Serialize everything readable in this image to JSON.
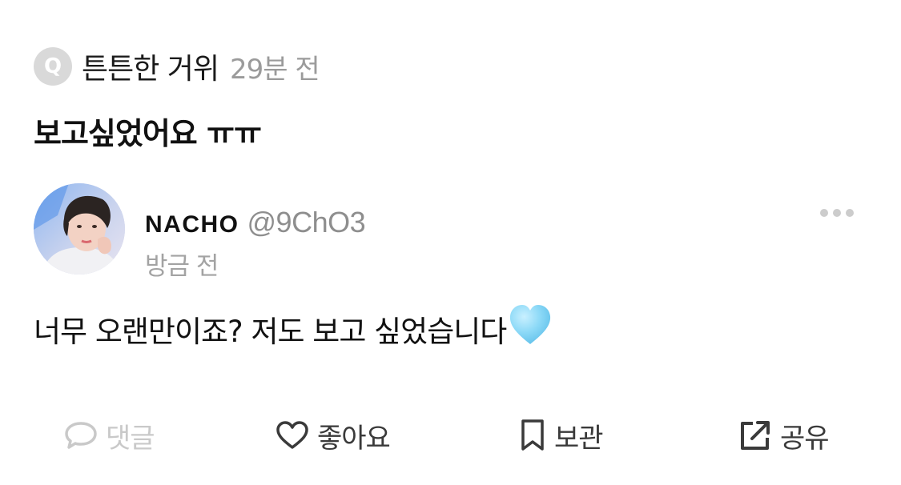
{
  "question": {
    "badge": "Q",
    "asker_name": "튼튼한 거위",
    "time": "29분 전",
    "text": "보고싶었어요 ㅠㅠ"
  },
  "answer": {
    "author_name": "NACHO",
    "author_handle": "@9ChO3",
    "time": "방금 전",
    "text": "너무 오랜만이죠? 저도 보고 싶었습니다",
    "emoji_icon": "light-blue-heart-icon"
  },
  "actions": {
    "comment_label": "댓글",
    "like_label": "좋아요",
    "save_label": "보관",
    "share_label": "공유"
  },
  "colors": {
    "muted_text": "#9b9b9b",
    "disabled_action": "#c9c9c9",
    "action_icon": "#3a3a3a",
    "heart_blue": "#7fd3f5",
    "badge_gray": "#d9d9d9"
  }
}
